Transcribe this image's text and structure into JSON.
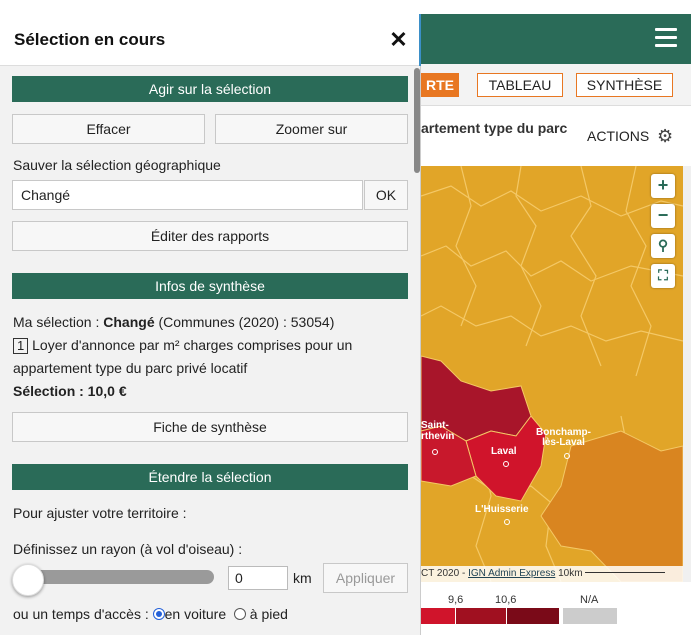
{
  "header": {
    "menu_icon": "hamburger-icon",
    "color": "#2a6b58"
  },
  "tabs": [
    {
      "label": "RTE",
      "active": true
    },
    {
      "label": "TABLEAU",
      "active": false
    },
    {
      "label": "SYNTHÈSE",
      "active": false
    }
  ],
  "map_title": {
    "text": "artement type du parc",
    "actions_label": "ACTIONS",
    "actions_icon": "gear-icon"
  },
  "map": {
    "controls": [
      "zoom-in-icon",
      "zoom-out-icon",
      "search-icon",
      "fullscreen-icon"
    ],
    "labels": {
      "saint": "Saint-",
      "berthevin": "rthevin",
      "laval": "Laval",
      "bonchamp1": "Bonchamp-",
      "bonchamp2": "lès-Laval",
      "huisserie": "L'Huisserie"
    },
    "attribution": {
      "prefix": "CT 2020 - ",
      "ign": "IGN Admin Express",
      "scale": "10km"
    },
    "colors": {
      "base": "#e1a528",
      "orange_dark": "#d97d20",
      "red": "#d0142b",
      "dark_red": "#a8152a"
    }
  },
  "legend": {
    "values": [
      "9,6",
      "10,6",
      "N/A"
    ],
    "colors": [
      "#d0142b",
      "#a01020",
      "#7a0a18",
      "#cccccc"
    ]
  },
  "panel": {
    "title": "Sélection en cours",
    "close_icon": "close-icon",
    "act_section": "Agir sur la sélection",
    "clear_button": "Effacer",
    "zoom_button": "Zoomer sur",
    "save_label": "Sauver la sélection géographique",
    "save_input_value": "Changé",
    "ok_button": "OK",
    "reports_button": "Éditer des rapports",
    "summary_section": "Infos de synthèse",
    "summary": {
      "selection_prefix": "Ma sélection : ",
      "selection_name": "Changé",
      "selection_detail": " (Communes (2020) : 53054)",
      "indicator_number": "1",
      "indicator_line1": "Loyer d'annonce par m² charges comprises pour un",
      "indicator_line2": "appartement type du parc privé locatif",
      "selection_value": "Sélection : 10,0 €"
    },
    "summary_sheet_button": "Fiche de synthèse",
    "extend_section": "Étendre la sélection",
    "adjust_label": "Pour ajuster votre territoire :",
    "radius_label": "Définissez un rayon (à vol d'oiseau) :",
    "radius_value": "0",
    "radius_unit": "km",
    "apply_button": "Appliquer",
    "access_label": "ou un temps d'accès :",
    "by_car": "en voiture",
    "on_foot": "à pied"
  }
}
